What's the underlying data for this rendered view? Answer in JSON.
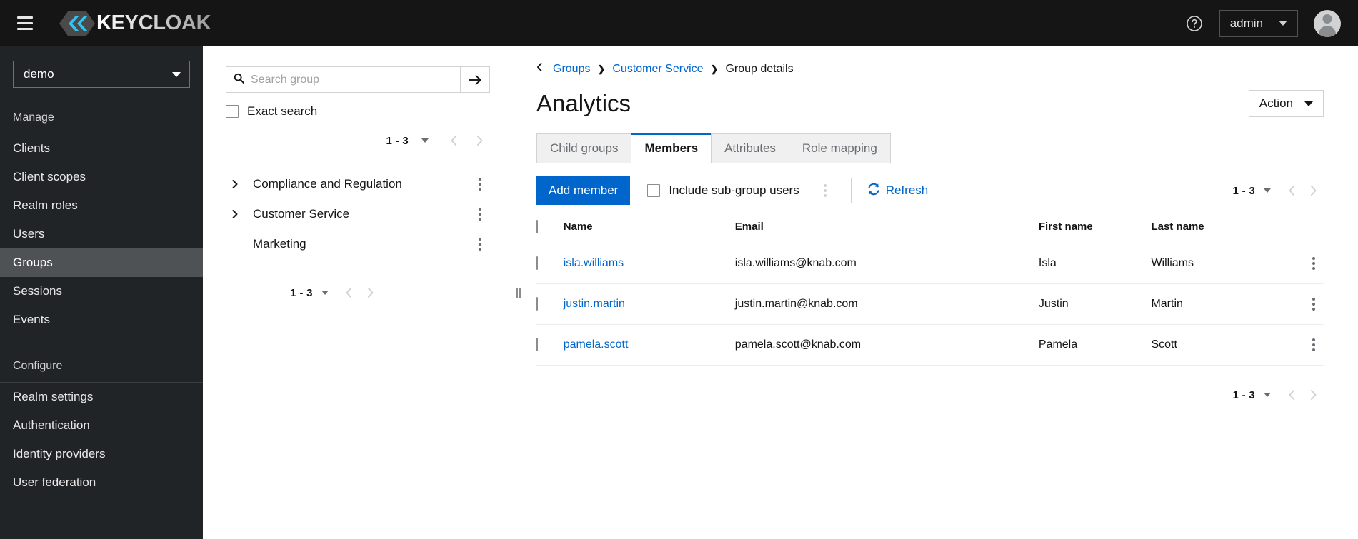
{
  "masthead": {
    "menu_icon": "hamburger-icon",
    "brand": "KEYCLOAK",
    "help_icon": "help-circle-icon",
    "user_label": "admin",
    "avatar_icon": "user-avatar-icon"
  },
  "sidebar": {
    "realm": "demo",
    "groups": [
      {
        "title": "Manage",
        "items": [
          {
            "label": "Clients",
            "active": false
          },
          {
            "label": "Client scopes",
            "active": false
          },
          {
            "label": "Realm roles",
            "active": false
          },
          {
            "label": "Users",
            "active": false
          },
          {
            "label": "Groups",
            "active": true
          },
          {
            "label": "Sessions",
            "active": false
          },
          {
            "label": "Events",
            "active": false
          }
        ]
      },
      {
        "title": "Configure",
        "items": [
          {
            "label": "Realm settings",
            "active": false
          },
          {
            "label": "Authentication",
            "active": false
          },
          {
            "label": "Identity providers",
            "active": false
          },
          {
            "label": "User federation",
            "active": false
          }
        ]
      }
    ]
  },
  "tree_panel": {
    "search_placeholder": "Search group",
    "search_value": "",
    "search_icon": "search-icon",
    "go_icon": "arrow-right-icon",
    "exact_search_label": "Exact search",
    "exact_search_checked": false,
    "top_pager": {
      "count": "1 - 3"
    },
    "bottom_pager": {
      "count": "1 - 3"
    },
    "items": [
      {
        "label": "Compliance and Regulation",
        "expandable": true
      },
      {
        "label": "Customer Service",
        "expandable": true
      },
      {
        "label": "Marketing",
        "expandable": false
      }
    ]
  },
  "content": {
    "breadcrumb": {
      "back_icon": "chevron-left-icon",
      "items": [
        {
          "label": "Groups",
          "link": true
        },
        {
          "label": "Customer Service",
          "link": true
        },
        {
          "label": "Group details",
          "link": false
        }
      ]
    },
    "title": "Analytics",
    "action_button": {
      "label": "Action",
      "caret_icon": "caret-down-icon"
    },
    "tabs": [
      {
        "label": "Child groups",
        "active": false
      },
      {
        "label": "Members",
        "active": true
      },
      {
        "label": "Attributes",
        "active": false
      },
      {
        "label": "Role mapping",
        "active": false
      }
    ],
    "toolbar": {
      "add_member_label": "Add member",
      "include_subgroup_label": "Include sub-group users",
      "include_subgroup_checked": false,
      "kebab_icon": "kebab-menu-icon",
      "refresh_label": "Refresh",
      "refresh_icon": "refresh-icon",
      "pager": {
        "count": "1 - 3"
      }
    },
    "table": {
      "columns": [
        "Name",
        "Email",
        "First name",
        "Last name"
      ],
      "rows": [
        {
          "name": "isla.williams",
          "email": "isla.williams@knab.com",
          "first_name": "Isla",
          "last_name": "Williams"
        },
        {
          "name": "justin.martin",
          "email": "justin.martin@knab.com",
          "first_name": "Justin",
          "last_name": "Martin"
        },
        {
          "name": "pamela.scott",
          "email": "pamela.scott@knab.com",
          "first_name": "Pamela",
          "last_name": "Scott"
        }
      ]
    },
    "bottom_pager": {
      "count": "1 - 3"
    }
  },
  "colors": {
    "masthead_bg": "#151515",
    "sidebar_bg": "#212427",
    "sidebar_active": "#4f5255",
    "accent_blue": "#0066cc",
    "tab_active_border": "#0066cc"
  }
}
